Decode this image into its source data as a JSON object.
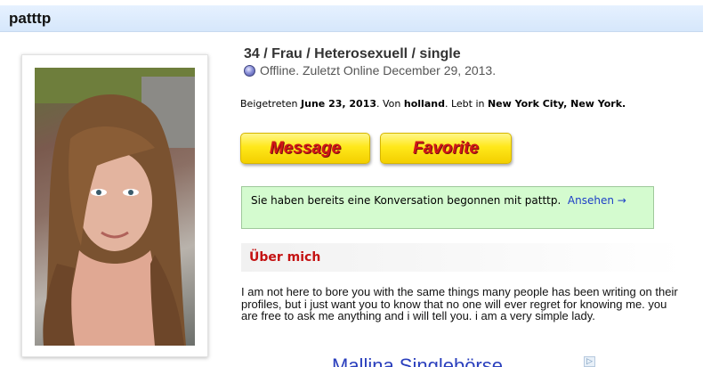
{
  "header": {
    "username": "patttp"
  },
  "profile": {
    "stats": "34 / Frau / Heterosexuell / single",
    "online_status": "Offline. Zuletzt Online December 29, 2013.",
    "joined_prefix": "Beigetreten ",
    "joined_date": "June 23, 2013",
    "joined_mid": ". Von ",
    "from": "holland",
    "lives_prefix": ". Lebt in ",
    "location": "New York City, New York",
    "location_suffix": "."
  },
  "actions": {
    "message_label": "Message",
    "favorite_label": "Favorite"
  },
  "notice": {
    "text": "Sie haben bereits eine Konversation begonnen mit patttp.",
    "link_label": "Ansehen →"
  },
  "about": {
    "heading": "Über mich",
    "text": "I am not here to bore you with the same things many people has been writing on their profiles, but i just want you to know that no one will ever regret for knowing me. you are free to ask me anything and i will tell you. i am a very simple lady."
  },
  "ad": {
    "text": "Mallina Singlebörse",
    "choices_icon": "▷"
  },
  "colors": {
    "accent_red": "#c41212",
    "button_yellow": "#ffe81a",
    "link_blue": "#1d3fc7",
    "notice_green": "#d4fbcf"
  }
}
